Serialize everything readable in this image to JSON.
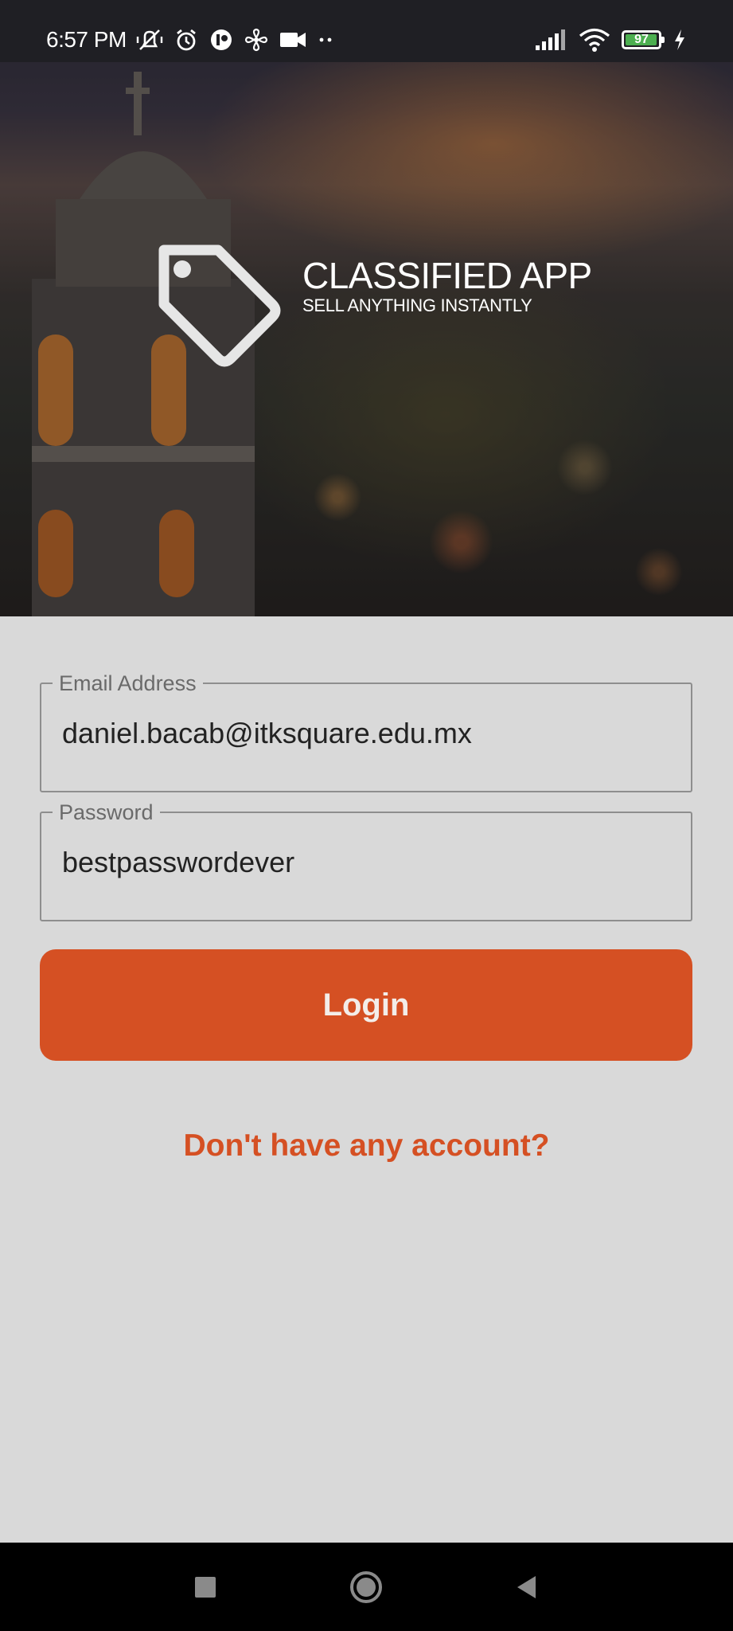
{
  "status_bar": {
    "time": "6:57 PM",
    "battery_level": "97",
    "battery_color": "#4caf50",
    "left_icons": [
      "mute-vibrate-icon",
      "alarm-icon",
      "app-icon",
      "fan-icon",
      "video-icon",
      "more-dots-icon"
    ],
    "right_icons": [
      "signal-icon",
      "wifi-icon",
      "battery-icon",
      "charging-icon"
    ]
  },
  "hero": {
    "logo_icon": "price-tag-icon",
    "title": "CLASSIFIED APP",
    "tagline": "SELL ANYTHING INSTANTLY"
  },
  "form": {
    "email": {
      "label": "Email Address",
      "value": "daniel.bacab@itksquare.edu.mx"
    },
    "password": {
      "label": "Password",
      "value": "bestpasswordever"
    },
    "login_label": "Login",
    "signup_link": "Don't have any account?"
  },
  "colors": {
    "accent": "#d55023",
    "background": "#d9d9d9"
  },
  "nav_bar": {
    "buttons": [
      "recents-icon",
      "home-icon",
      "back-icon"
    ]
  }
}
